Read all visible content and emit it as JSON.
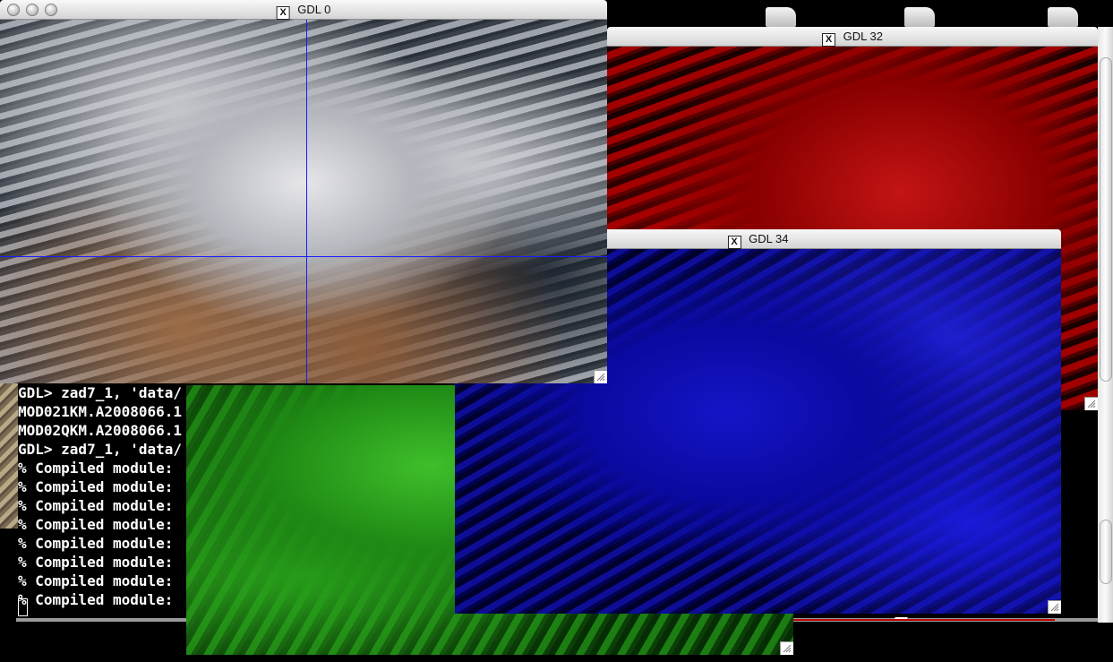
{
  "terminal": {
    "lines": [
      "GDL> zad7_1, 'data/",
      "MOD021KM.A2008066.1",
      "MOD02QKM.A2008066.1",
      "GDL> zad7_1, 'data/",
      "% Compiled module: ",
      "% Compiled module: ",
      "% Compiled module: ",
      "% Compiled module: ",
      "% Compiled module: ",
      "% Compiled module: ",
      "% Compiled module: ",
      "% Compiled module: "
    ]
  },
  "windows": {
    "gdl0": {
      "title": "GDL 0",
      "x_icon": "X",
      "image": "grayscale satellite cloud image",
      "crosshair_color": "#1a1aff"
    },
    "gdl32": {
      "title": "GDL 32",
      "x_icon": "X",
      "image": "red channel satellite image"
    },
    "gdl34": {
      "title": "GDL 34",
      "x_icon": "X",
      "image": "blue channel satellite image"
    },
    "green": {
      "image": "green channel satellite image"
    }
  },
  "colors": {
    "red_channel": "#c41414",
    "green_channel": "#2ba61c",
    "blue_channel": "#1515c8",
    "terminal_bg": "#000000",
    "terminal_text": "#ffffff"
  },
  "icons": [
    "close-button-icon",
    "minimize-button-icon",
    "zoom-button-icon",
    "x11-window-icon",
    "resize-grip-icon",
    "desktop-drive-icon"
  ]
}
